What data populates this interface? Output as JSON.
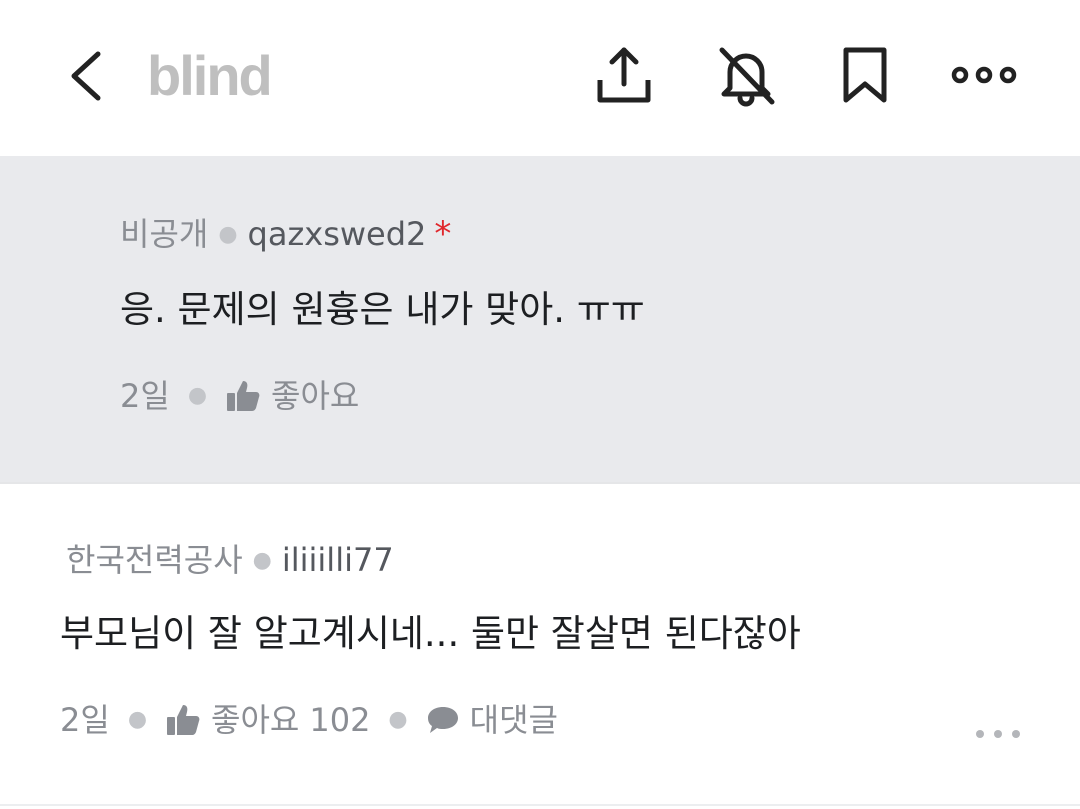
{
  "header": {
    "logo": "blind",
    "icons": [
      "back-icon",
      "share-icon",
      "notification-off-icon",
      "bookmark-icon",
      "more-icon"
    ]
  },
  "reply": {
    "company": "비공개",
    "nickname": "qazxswed2",
    "author_mark": "*",
    "text": "응. 문제의 원흉은 내가 맞아. ㅠㅠ",
    "time": "2일",
    "like_label": "좋아요"
  },
  "comment": {
    "company": "한국전력공사",
    "nickname": "iliiilli77",
    "text": "부모님이 잘 알고계시네... 둘만 잘살면 된다잖아",
    "time": "2일",
    "like_label": "좋아요",
    "like_count": "102",
    "reply_label": "대댓글"
  },
  "colors": {
    "reply_bg": "#e9eaed",
    "logo": "#bfbfbf",
    "author_mark": "#e0272c"
  }
}
